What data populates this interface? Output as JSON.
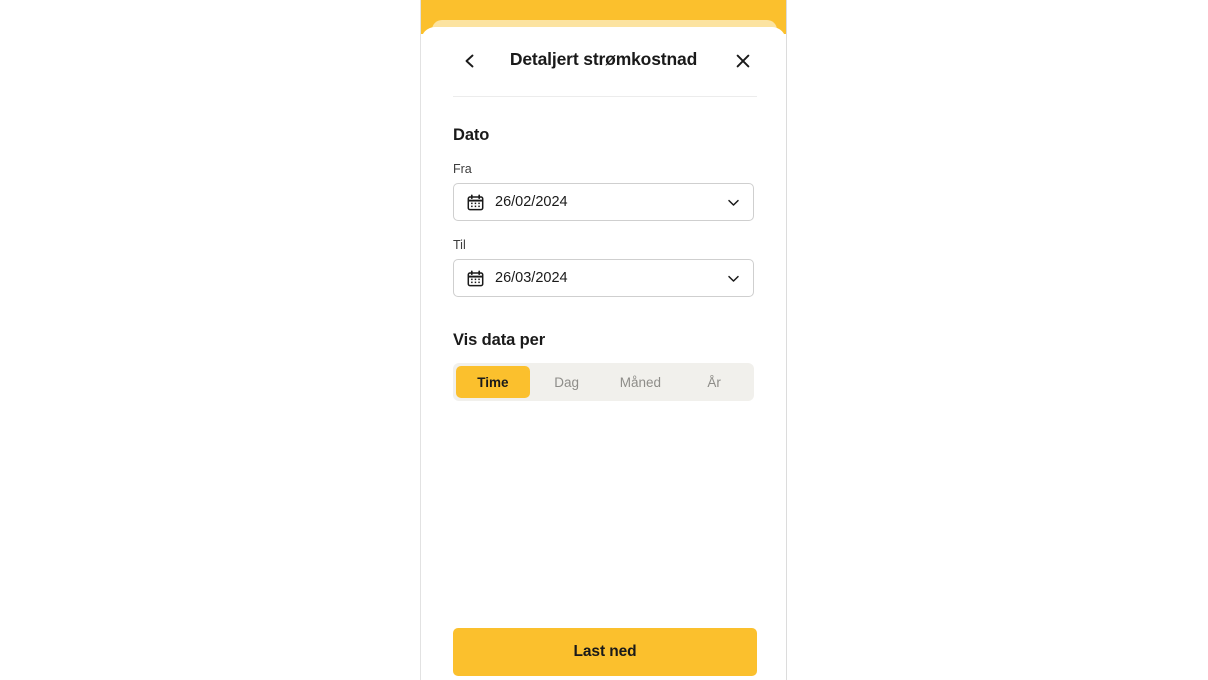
{
  "theme": {
    "accent": "#FBC02D",
    "accent_light": "#FCE3A0",
    "segment_track": "#F1F0EC",
    "text": "#1a1a1a",
    "muted_text": "#8e8d89",
    "border": "#cfcfcf"
  },
  "header": {
    "title": "Detaljert strømkostnad",
    "back_icon": "chevron-left-icon",
    "close_icon": "close-icon"
  },
  "date_section": {
    "heading": "Dato",
    "from": {
      "label": "Fra",
      "value": "26/02/2024",
      "icon": "calendar-icon",
      "chevron": "chevron-down-icon"
    },
    "to": {
      "label": "Til",
      "value": "26/03/2024",
      "icon": "calendar-icon",
      "chevron": "chevron-down-icon"
    }
  },
  "resolution_section": {
    "heading": "Vis data per",
    "options": [
      {
        "label": "Time",
        "selected": true
      },
      {
        "label": "Dag",
        "selected": false
      },
      {
        "label": "Måned",
        "selected": false
      },
      {
        "label": "År",
        "selected": false
      }
    ],
    "selected_value": "Time"
  },
  "footer": {
    "download_label": "Last ned"
  }
}
